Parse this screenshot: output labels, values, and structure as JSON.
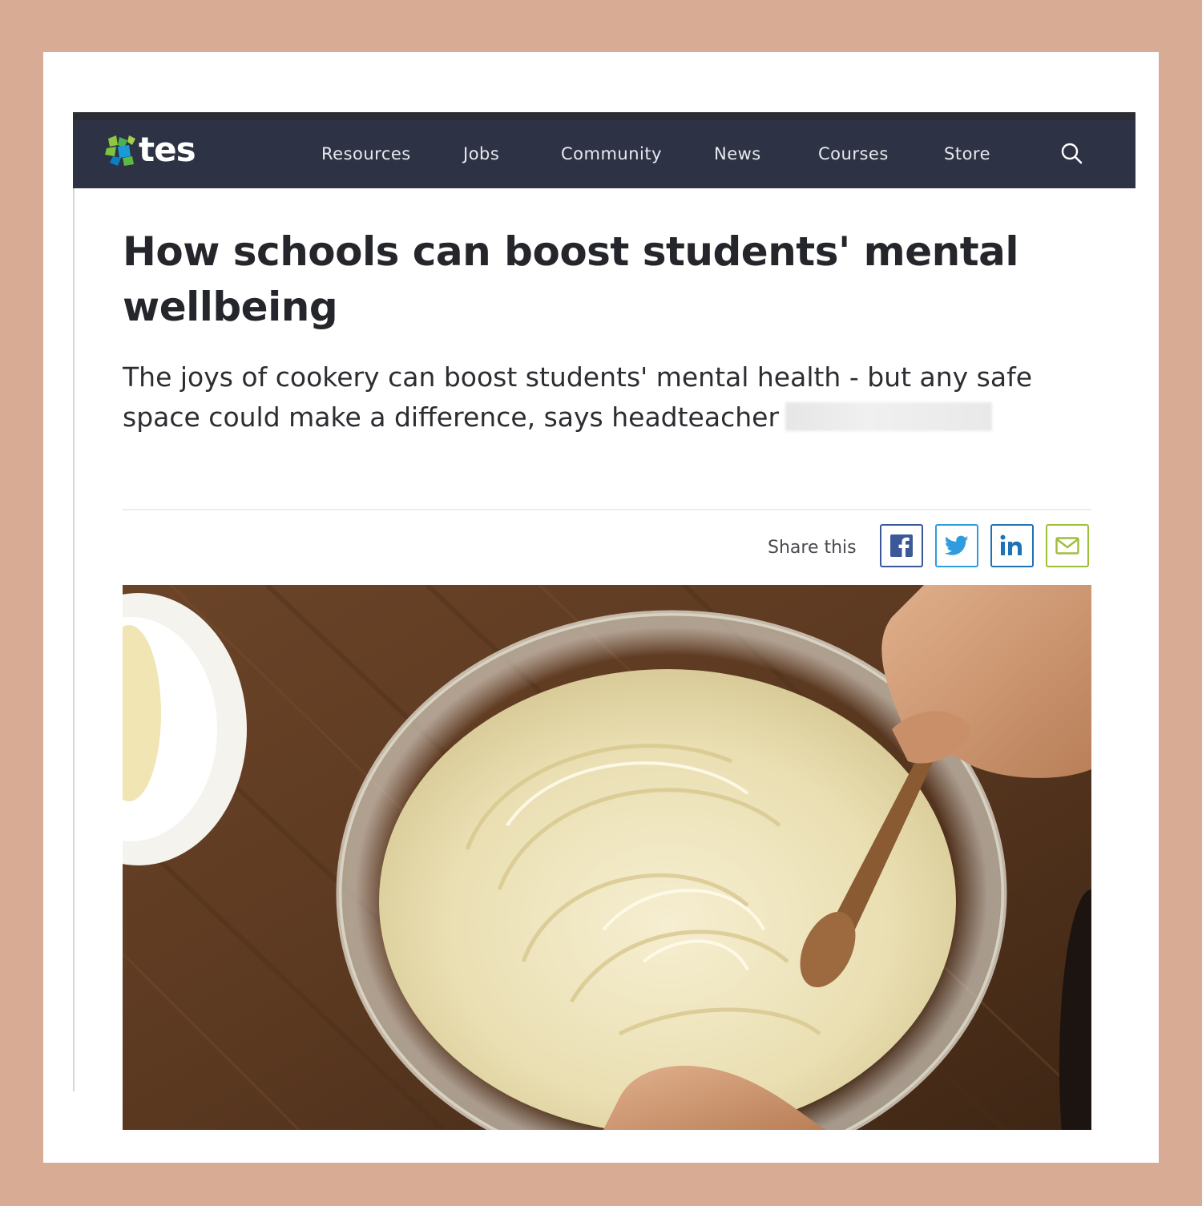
{
  "brand": {
    "name": "tes"
  },
  "nav": {
    "items": [
      {
        "label": "Resources"
      },
      {
        "label": "Jobs"
      },
      {
        "label": "Community"
      },
      {
        "label": "News"
      },
      {
        "label": "Courses"
      },
      {
        "label": "Store"
      }
    ],
    "search_icon": "search-icon"
  },
  "article": {
    "title": "How schools can boost students' mental wellbeing",
    "standfirst": "The joys of cookery can boost students' mental health - but any safe space could make a difference, says headteacher"
  },
  "share": {
    "label": "Share this",
    "buttons": [
      {
        "icon": "facebook-icon",
        "color": "#3b5998"
      },
      {
        "icon": "twitter-icon",
        "color": "#2f9ce0"
      },
      {
        "icon": "linkedin-icon",
        "color": "#1d72b8"
      },
      {
        "icon": "email-icon",
        "color": "#9fbe3b"
      }
    ]
  },
  "colors": {
    "frame": "#d8ab94",
    "navbar": "#2d3245",
    "title": "#25262b"
  }
}
